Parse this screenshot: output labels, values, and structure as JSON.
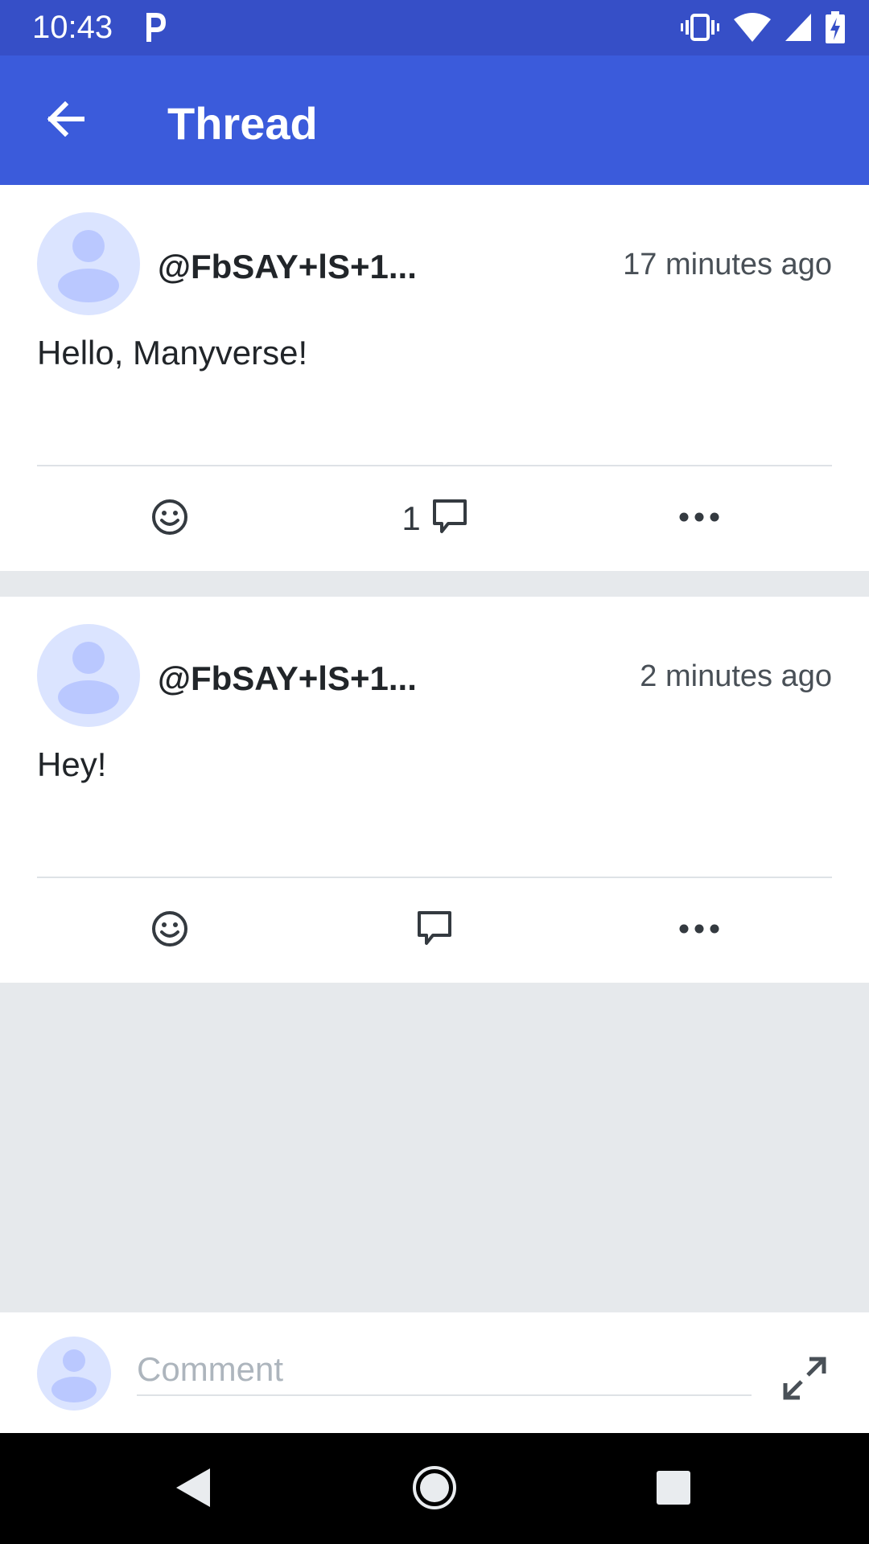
{
  "status_bar": {
    "time": "10:43",
    "notification_icon": "parking-p-icon",
    "icons": [
      "vibrate-icon",
      "wifi-icon",
      "cell-signal-icon",
      "battery-charging-icon"
    ]
  },
  "app_bar": {
    "title": "Thread",
    "back_icon": "arrow-left-icon"
  },
  "posts": [
    {
      "author": "@FbSAY+lS+1...",
      "timestamp": "17 minutes ago",
      "text": "Hello, Manyverse!",
      "reply_count": "1"
    },
    {
      "author": "@FbSAY+lS+1...",
      "timestamp": "2 minutes ago",
      "text": "Hey!",
      "reply_count": ""
    }
  ],
  "composer": {
    "placeholder": "Comment",
    "expand_icon": "expand-icon"
  },
  "colors": {
    "status_bar": "#364fc7",
    "app_bar": "#3b5bdb",
    "avatar_bg": "#dbe4ff",
    "avatar_fg": "#bac8ff",
    "background": "#e6e9ec"
  }
}
